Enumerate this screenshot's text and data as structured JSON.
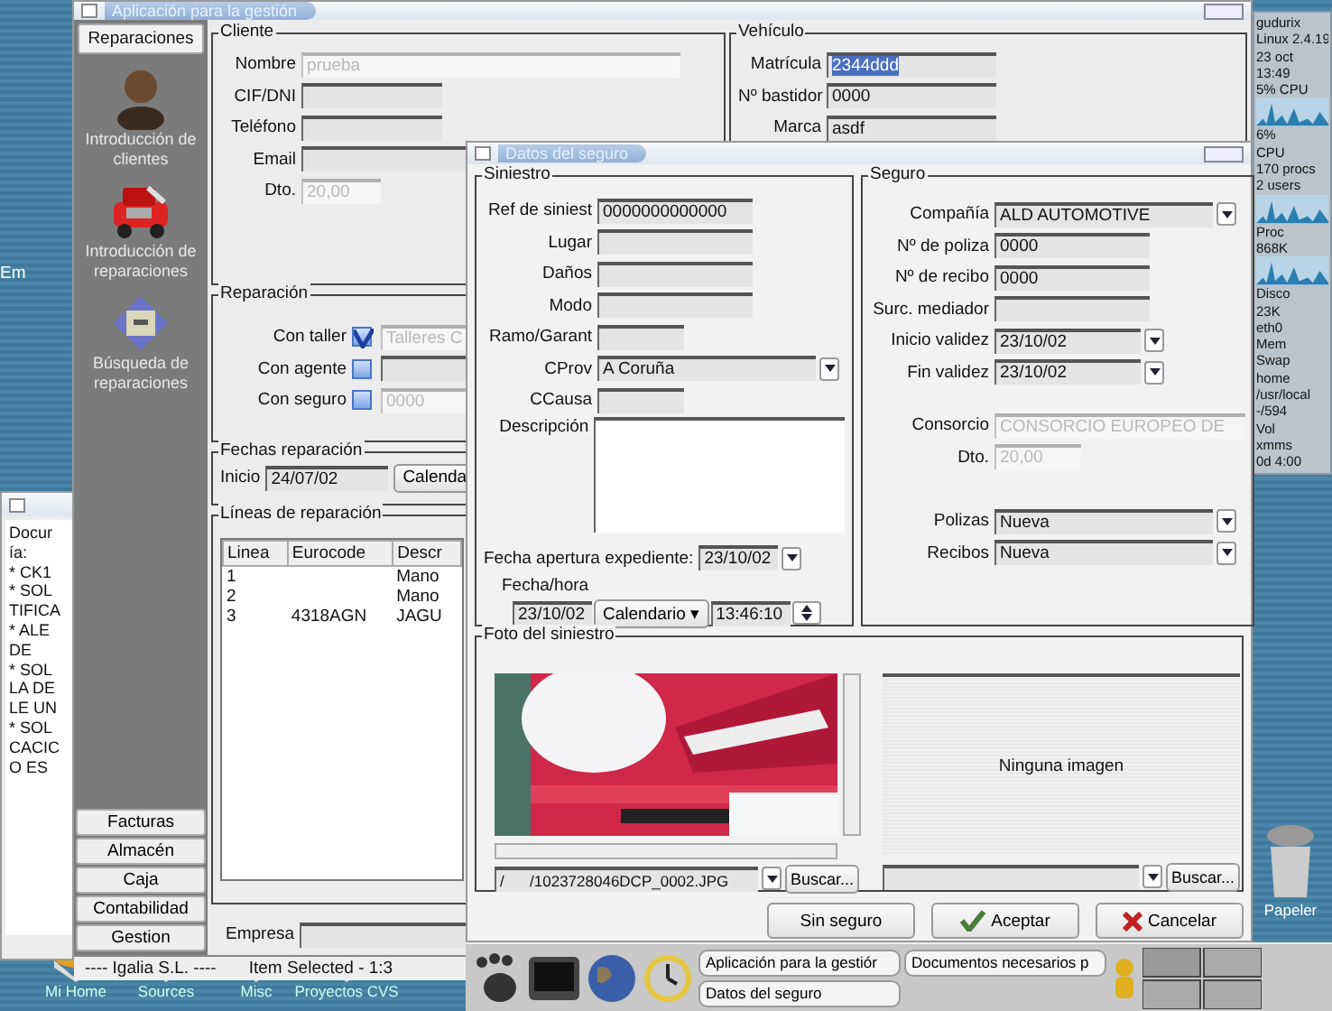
{
  "desktop": {
    "side_label": "Em",
    "icons": [
      {
        "label": "Mi Home"
      },
      {
        "label": "Sources"
      },
      {
        "label": "Misc"
      },
      {
        "label": "Proyectos CVS"
      }
    ],
    "trash": {
      "label": "Papeler"
    }
  },
  "monitor": {
    "items": [
      {
        "kind": "label",
        "text": "gudurix"
      },
      {
        "kind": "label",
        "text": "Linux 2.4.19"
      },
      {
        "kind": "label",
        "text": "23 oct"
      },
      {
        "kind": "label",
        "text": "13:49"
      },
      {
        "kind": "label",
        "text": "5% CPU"
      },
      {
        "kind": "graph"
      },
      {
        "kind": "label",
        "text": "6%"
      },
      {
        "kind": "label",
        "text": "CPU"
      },
      {
        "kind": "label",
        "text": "170 procs"
      },
      {
        "kind": "label",
        "text": "2 users"
      },
      {
        "kind": "graph"
      },
      {
        "kind": "label",
        "text": "Proc"
      },
      {
        "kind": "label",
        "text": "868K"
      },
      {
        "kind": "graph"
      },
      {
        "kind": "label",
        "text": "Disco"
      },
      {
        "kind": "label",
        "text": "23K"
      },
      {
        "kind": "label",
        "text": "eth0"
      },
      {
        "kind": "label",
        "text": "Mem"
      },
      {
        "kind": "label",
        "text": "Swap"
      },
      {
        "kind": "label",
        "text": "home"
      },
      {
        "kind": "label",
        "text": "/usr/local"
      },
      {
        "kind": "label",
        "text": "-/594"
      },
      {
        "kind": "label",
        "text": "Vol"
      },
      {
        "kind": "label",
        "text": "xmms"
      },
      {
        "kind": "label",
        "text": "0d 4:00"
      }
    ]
  },
  "back_window": {
    "lines": [
      "Docur",
      "ía:",
      "* CK1",
      "* SOL",
      "TIFICA",
      "* ALE",
      "DE",
      "* SOL",
      "LA DE",
      "LE UN",
      "* SOL",
      "CACIC",
      "O ES"
    ]
  },
  "main_window": {
    "title": "Aplicación para la gestión",
    "sidebar": {
      "tab": "Reparaciones",
      "items": [
        {
          "label": "Introducción de clientes",
          "kind": "person"
        },
        {
          "label": "Introducción de reparaciones",
          "kind": "car"
        },
        {
          "label": "Búsqueda de reparaciones",
          "kind": "toolbox"
        }
      ],
      "buttons": [
        "Facturas",
        "Almacén",
        "Caja",
        "Contabilidad",
        "Gestion"
      ]
    },
    "cliente": {
      "title": "Cliente",
      "fields": [
        {
          "label": "Nombre",
          "value": "prueba",
          "kind": "long",
          "disabled": true
        },
        {
          "label": "CIF/DNI",
          "kind": "text",
          "disabled": false
        },
        {
          "label": "Teléfono",
          "kind": "text",
          "disabled": false
        },
        {
          "label": "Email",
          "kind": "long",
          "disabled": false
        },
        {
          "label": "Dto.",
          "value": "20,00",
          "kind": "short",
          "disabled": true
        }
      ]
    },
    "vehiculo": {
      "title": "Vehículo",
      "fields": [
        {
          "label": "Matrícula",
          "value": "2344ddd",
          "disabled": false,
          "value_selected": true
        },
        {
          "label": "Nº bastidor",
          "value": "0000",
          "disabled": false,
          "value_selected": false
        },
        {
          "label": "Marca",
          "value": "asdf",
          "disabled": false,
          "value_selected": false
        }
      ]
    },
    "reparacion": {
      "title": "Reparación",
      "options": [
        {
          "label": "Con taller",
          "checked": true,
          "value": "Talleres C",
          "disabled": true
        },
        {
          "label": "Con agente",
          "checked": false,
          "disabled": false
        },
        {
          "label": "Con seguro",
          "checked": false,
          "value": "0000",
          "disabled": true
        }
      ]
    },
    "fechas": {
      "title": "Fechas reparación",
      "label": "Inicio",
      "value": "24/07/02",
      "button": "Calenda"
    },
    "lineas": {
      "title": "Líneas de reparación",
      "columns": [
        "Linea",
        "Eurocode",
        "Descr"
      ],
      "rows": [
        {
          "linea": "1",
          "descr": "Mano"
        },
        {
          "linea": "2",
          "descr": "Mano"
        },
        {
          "linea": "3",
          "eurocode": "4318AGN",
          "descr": "JAGU"
        }
      ]
    },
    "empresa": {
      "label": "Empresa"
    },
    "status_bar": [
      "---- Igalia S.L. ----",
      "Item Selected - 1:3"
    ]
  },
  "dialog": {
    "title": "Datos del seguro",
    "siniestro": {
      "title": "Siniestro",
      "fields": [
        {
          "label": "Ref de siniest",
          "value": "0000000000000",
          "kind": "text",
          "disabled": false
        },
        {
          "label": "Lugar",
          "kind": "text",
          "disabled": false
        },
        {
          "label": "Daños",
          "kind": "text",
          "disabled": false
        },
        {
          "label": "Modo",
          "kind": "text",
          "disabled": false
        },
        {
          "label": "Ramo/Garant",
          "kind": "short",
          "disabled": false
        },
        {
          "label": "CProv",
          "value": "A Coruña",
          "kind": "combo",
          "disabled": false
        },
        {
          "label": "CCausa",
          "kind": "short",
          "disabled": false
        },
        {
          "label": "Descripción",
          "kind": "area",
          "disabled": false
        }
      ],
      "apertura": {
        "label": "Fecha apertura expediente:",
        "value": "23/10/02"
      },
      "fecha_hora": {
        "label": "Fecha/hora",
        "date": "23/10/02",
        "button": "Calendario ▾",
        "time": "13:46:10"
      }
    },
    "seguro": {
      "title": "Seguro",
      "fields": [
        {
          "label": "Compañía",
          "value": "ALD AUTOMOTIVE",
          "kind": "combo",
          "disabled": false
        },
        {
          "label": "Nº de poliza",
          "value": "0000",
          "kind": "text",
          "disabled": false
        },
        {
          "label": "Nº de recibo",
          "value": "0000",
          "kind": "text",
          "disabled": false
        },
        {
          "label": "Surc. mediador",
          "kind": "text",
          "disabled": false
        },
        {
          "label": "Inicio validez",
          "value": "23/10/02",
          "kind": "date",
          "disabled": false
        },
        {
          "label": "Fin validez",
          "value": "23/10/02",
          "kind": "date",
          "disabled": false
        },
        {
          "label": "Consorcio",
          "value": "CONSORCIO EUROPEO DE",
          "kind": "long",
          "disabled": true
        },
        {
          "label": "Dto.",
          "value": "20,00",
          "kind": "short",
          "disabled": true
        },
        {
          "label": "Polizas",
          "value": "Nueva",
          "kind": "combo",
          "disabled": false
        },
        {
          "label": "Recibos",
          "value": "Nueva",
          "kind": "combo",
          "disabled": false
        }
      ]
    },
    "foto": {
      "title": "Foto del siniestro",
      "left": {
        "kind": "picture",
        "path": "/      /1023728046DCP_0002.JPG",
        "button": "Buscar..."
      },
      "right": {
        "message": "Ninguna imagen",
        "button": "Buscar..."
      }
    },
    "buttons": [
      {
        "label": "Sin seguro",
        "kind": "plain"
      },
      {
        "label": "Aceptar",
        "kind": "accept"
      },
      {
        "label": "Cancelar",
        "kind": "cancel"
      }
    ]
  },
  "taskbar": {
    "tasks": [
      "Aplicación para la gestiór",
      "Documentos necesarios p",
      "Datos del seguro"
    ]
  }
}
